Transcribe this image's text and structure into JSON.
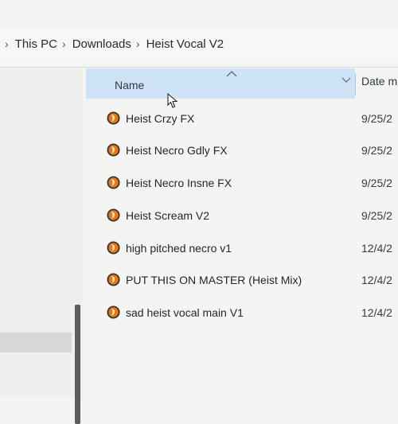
{
  "breadcrumb": {
    "items": [
      "This PC",
      "Downloads",
      "Heist Vocal V2"
    ],
    "separator": "›"
  },
  "columns": {
    "name": "Name",
    "date": "Date m"
  },
  "files": [
    {
      "name": "Heist Crzy FX",
      "date": "9/25/2"
    },
    {
      "name": "Heist Necro Gdly FX",
      "date": "9/25/2"
    },
    {
      "name": "Heist Necro Insne FX",
      "date": "9/25/2"
    },
    {
      "name": "Heist Scream V2",
      "date": "9/25/2"
    },
    {
      "name": "high pitched necro v1",
      "date": "12/4/2"
    },
    {
      "name": "PUT THIS ON MASTER (Heist Mix)",
      "date": "12/4/2"
    },
    {
      "name": "sad heist vocal main V1",
      "date": "12/4/2"
    }
  ],
  "icons": {
    "file": "fl-studio-project-icon",
    "sort": "sort-ascending-icon",
    "chevron": "chevron-down-icon",
    "cursor": "mouse-cursor-icon"
  },
  "colors": {
    "header_highlight": "#cfe3f6",
    "background": "#f4f5f3",
    "nav_selected": "#d6d8d6"
  }
}
